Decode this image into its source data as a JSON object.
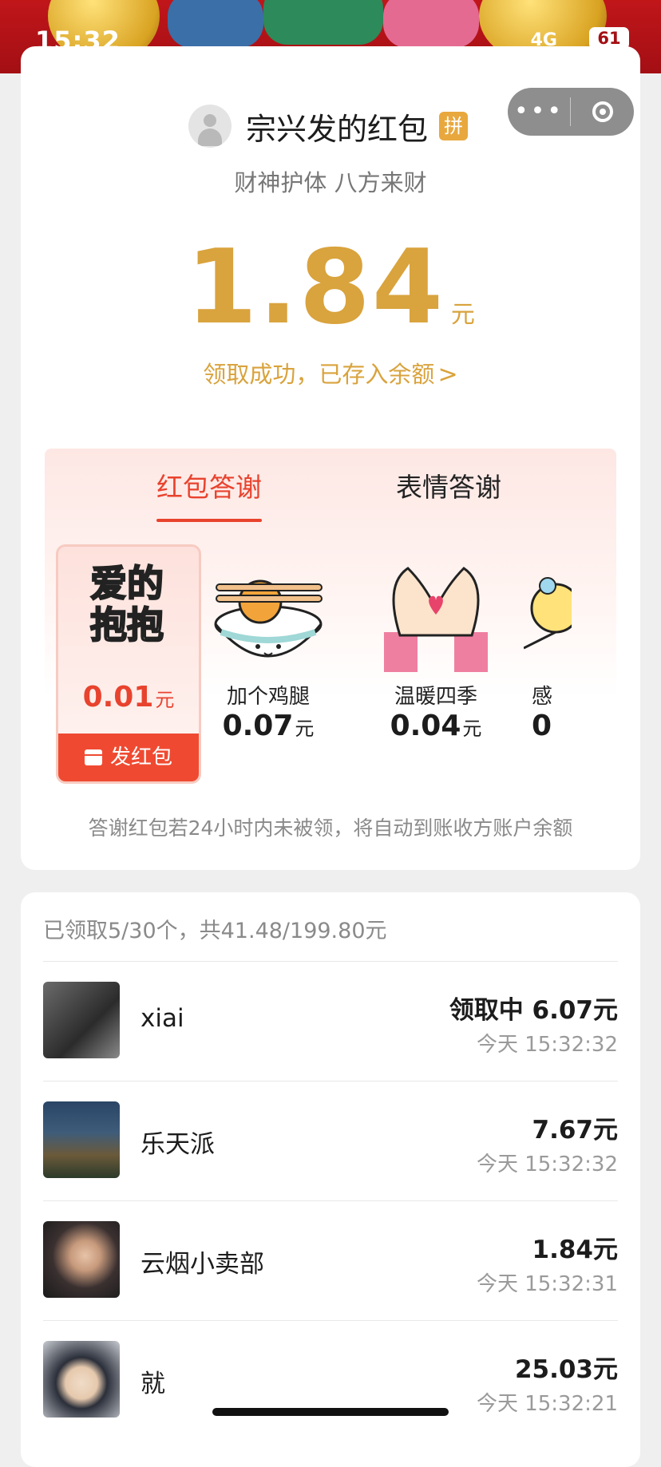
{
  "status_bar": {
    "time": "15:32",
    "network": "4G",
    "battery": "61"
  },
  "capsule": {
    "more_icon": "more-dots-icon",
    "close_icon": "target-circle-icon"
  },
  "envelope": {
    "sender": "宗兴发的红包",
    "badge": "拼",
    "blessing": "财神护体 八方来财",
    "amount": "1.84",
    "unit": "元",
    "claim_status": "领取成功，已存入余额",
    "claim_chevron": ">"
  },
  "thanks": {
    "tabs": [
      "红包答谢",
      "表情答谢"
    ],
    "active_tab": 0,
    "gifts": [
      {
        "name": "",
        "art_line1": "爱的",
        "art_line2": "抱抱",
        "price": "0.01",
        "unit": "元",
        "selected": true,
        "send_label": "发红包"
      },
      {
        "name": "加个鸡腿",
        "price": "0.07",
        "unit": "元"
      },
      {
        "name": "温暖四季",
        "price": "0.04",
        "unit": "元"
      },
      {
        "name": "感",
        "price": "0",
        "unit": ""
      }
    ],
    "note": "答谢红包若24小时内未被领，将自动到账收方账户余额"
  },
  "receivers": {
    "summary": "已领取5/30个，共41.48/199.80元",
    "rows": [
      {
        "name": "xiai",
        "amount": "领取中 6.07元",
        "time": "今天 15:32:32"
      },
      {
        "name": "乐天派",
        "amount": "7.67元",
        "time": "今天 15:32:32"
      },
      {
        "name": "云烟小卖部",
        "amount": "1.84元",
        "time": "今天 15:32:31"
      },
      {
        "name": "就",
        "amount": "25.03元",
        "time": "今天 15:32:21"
      }
    ]
  }
}
